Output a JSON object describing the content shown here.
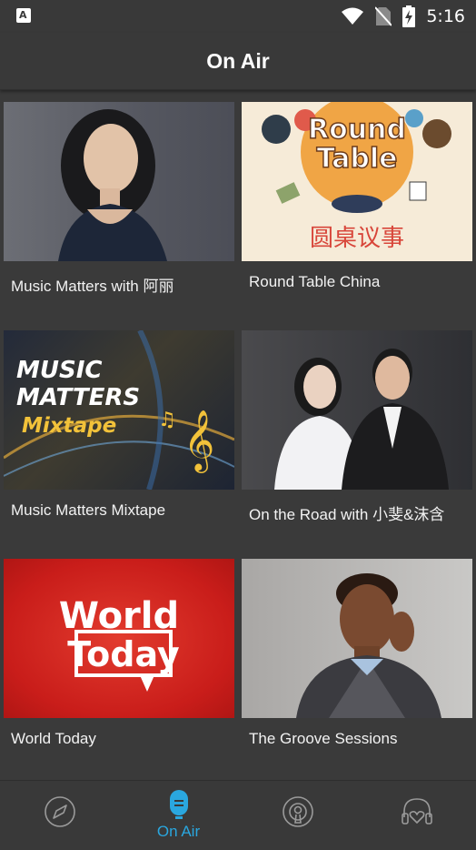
{
  "status_bar": {
    "time": "5:16",
    "icons": [
      "app-notification-icon",
      "wifi-icon",
      "no-sim-icon",
      "battery-charging-icon"
    ]
  },
  "header": {
    "title": "On Air"
  },
  "programs": [
    {
      "title": "Music Matters with 阿丽",
      "image": "host-portrait-woman"
    },
    {
      "title": "Round Table China",
      "image": "round-table-logo",
      "logo_line1": "Round",
      "logo_line2": "Table",
      "logo_chinese": "圆桌议事"
    },
    {
      "title": "Music Matters Mixtape",
      "image": "music-matters-mixtape-art",
      "art_line1": "MUSIC",
      "art_line2": "MATTERS",
      "art_line3": "Mixtape"
    },
    {
      "title": "On the Road with 小斐&沫含",
      "image": "two-hosts-portrait"
    },
    {
      "title": "World Today",
      "image": "world-today-logo",
      "logo_line1": "World",
      "logo_line2": "Today"
    },
    {
      "title": "The Groove Sessions",
      "image": "host-portrait-man"
    }
  ],
  "bottom_nav": {
    "active_index": 1,
    "active_label": "On Air",
    "items": [
      {
        "icon": "discover-icon"
      },
      {
        "icon": "microphone-icon",
        "label": "On Air"
      },
      {
        "icon": "podcast-icon"
      },
      {
        "icon": "favorites-headphones-icon"
      }
    ],
    "active_color": "#2aa7df",
    "inactive_color": "#9a9a9a"
  },
  "colors": {
    "background": "#3a3a3a",
    "accent": "#2aa7df"
  }
}
